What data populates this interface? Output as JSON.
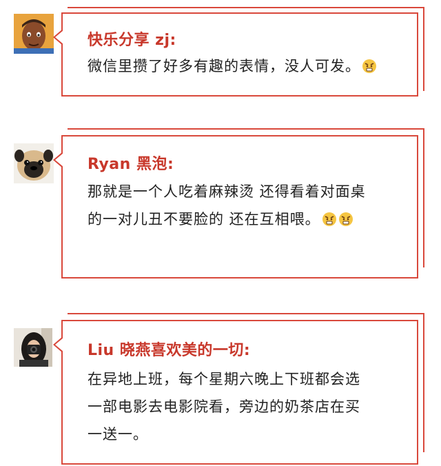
{
  "comments": [
    {
      "author": "快乐分享 zj:",
      "avatar_icon": "cartoon-man-avatar-icon",
      "line1": "微信里攒了好多有趣的表情，没人可发。",
      "emojis": [
        "angry-emoji-icon"
      ]
    },
    {
      "author": "Ryan 黑泡:",
      "avatar_icon": "pug-dog-avatar-icon",
      "line1": "那就是一个人吃着麻辣烫 还得看着对面桌",
      "line2": "的一对儿丑不要脸的 还在互相喂。",
      "emojis": [
        "angry-emoji-icon",
        "angry-emoji-icon"
      ]
    },
    {
      "author": "Liu 晓燕喜欢美的一切:",
      "avatar_icon": "woman-with-camera-avatar-icon",
      "line1": "在异地上班，每个星期六晚上下班都会选",
      "line2": "一部电影去电影院看，旁边的奶茶店在买",
      "line3": "一送一。"
    }
  ],
  "colors": {
    "accent": "#d9483b",
    "author_text": "#c8382b",
    "body_text": "#222222"
  }
}
